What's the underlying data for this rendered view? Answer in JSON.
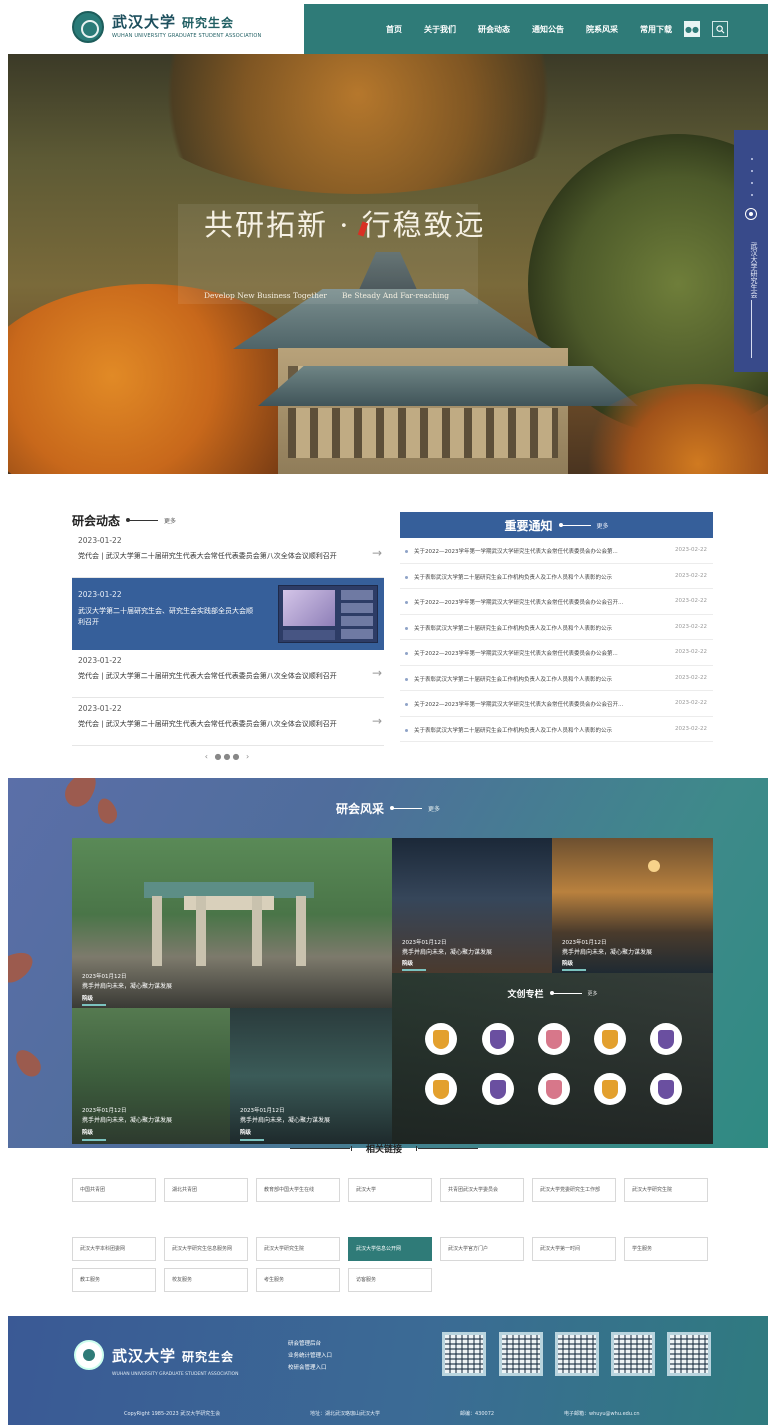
{
  "header": {
    "logo": {
      "name_cn": "武汉大学",
      "association": "研究生会",
      "name_en": "WUHAN UNIVERSITY GRADUATE STUDENT ASSOCIATION"
    },
    "nav": [
      "首页",
      "关于我们",
      "研会动态",
      "通知公告",
      "院系风采",
      "常用下载"
    ],
    "wechat_icon": "wechat-icon",
    "search_icon": "search-icon",
    "accent": "#2f7b78"
  },
  "banner": {
    "title": "共研拓新 · 行稳致远",
    "subtitle_left": "Develop New Business Together",
    "subtitle_right": "Be Steady And Far-reaching",
    "side_text": "武汉大学研究生会",
    "side_color": "#384a8a"
  },
  "news": {
    "title": "研会动态",
    "more": "更多",
    "items": [
      {
        "date": "2023-01-22",
        "title": "党代会 | 武汉大学第二十届研究生代表大会常任代表委员会第八次全体会议顺利召开"
      },
      {
        "date": "2023-01-22",
        "title": "武汉大学第二十届研究生会、研究生会实践部全员大会顺利召开",
        "featured": true
      },
      {
        "date": "2023-01-22",
        "title": "党代会 | 武汉大学第二十届研究生代表大会常任代表委员会第八次全体会议顺利召开"
      },
      {
        "date": "2023-01-22",
        "title": "党代会 | 武汉大学第二十届研究生代表大会常任代表委员会第八次全体会议顺利召开"
      }
    ],
    "pager": "‹ ●●● ›"
  },
  "notices": {
    "title": "重要通知",
    "more": "更多",
    "items": [
      {
        "title": "关于2022—2023学年第一学期武汉大学研究生代表大会常任代表委员会办公会第...",
        "date": "2023-02-22"
      },
      {
        "title": "关于表彰武汉大学第二十届研究生会工作机构负责人及工作人员和个人表彰的公示",
        "date": "2023-02-22"
      },
      {
        "title": "关于2022—2023学年第一学期武汉大学研究生代表大会常任代表委员会办公会召开...",
        "date": "2023-02-22"
      },
      {
        "title": "关于表彰武汉大学第二十届研究生会工作机构负责人及工作人员和个人表彰的公示",
        "date": "2023-02-22"
      },
      {
        "title": "关于2022—2023学年第一学期武汉大学研究生代表大会常任代表委员会办公会第...",
        "date": "2023-02-22"
      },
      {
        "title": "关于表彰武汉大学第二十届研究生会工作机构负责人及工作人员和个人表彰的公示",
        "date": "2023-02-22"
      },
      {
        "title": "关于2022—2023学年第一学期武汉大学研究生代表大会常任代表委员会办公会召开...",
        "date": "2023-02-22"
      },
      {
        "title": "关于表彰武汉大学第二十届研究生会工作机构负责人及工作人员和个人表彰的公示",
        "date": "2023-02-22"
      }
    ]
  },
  "style": {
    "title": "研会风采",
    "more": "更多",
    "tiles": [
      {
        "date": "2023年01月12日",
        "title": "携手并肩向未来，凝心聚力谋发展",
        "tag": "院级"
      },
      {
        "date": "2023年01月12日",
        "title": "携手并肩向未来，凝心聚力谋发展",
        "tag": "院级"
      },
      {
        "date": "2023年01月12日",
        "title": "携手并肩向未来，凝心聚力谋发展",
        "tag": "院级"
      },
      {
        "date": "2023年01月12日",
        "title": "携手并肩向未来，凝心聚力谋发展",
        "tag": "院级"
      },
      {
        "date": "2023年01月12日",
        "title": "携手并肩向未来，凝心聚力谋发展",
        "tag": "院级"
      }
    ],
    "column": {
      "title": "文创专栏",
      "more": "更多"
    }
  },
  "links": {
    "title": "相关链接",
    "items": [
      "中国共青团",
      "湖北共青团",
      "教育部中国大学生在线",
      "武汉大学",
      "共青团武汉大学委员会",
      "武汉大学党委研究生工作部",
      "武汉大学研究生院",
      "武汉大学本科团委网",
      "武汉大学研究生信息服务网",
      "武汉大学研究生院",
      "武汉大学信息公开网",
      "武汉大学官方门户",
      "武汉大学第一时间",
      "学生服务",
      "教工服务",
      "校友服务",
      "考生服务",
      "访客服务"
    ]
  },
  "footer": {
    "logo_cn": "武汉大学",
    "association": "研究生会",
    "logo_en": "WUHAN UNIVERSITY GRADUATE STUDENT ASSOCIATION",
    "links": [
      "研会管理后台",
      "业务统计管理入口",
      "校研会管理入口"
    ],
    "copyright": "CopyRight 1985-2023 武汉大学研究生会",
    "address": "地址：湖北武汉珞珈山武汉大学",
    "postcode": "邮编：430072",
    "email": "电子邮箱：whuyu@whu.edu.cn"
  }
}
